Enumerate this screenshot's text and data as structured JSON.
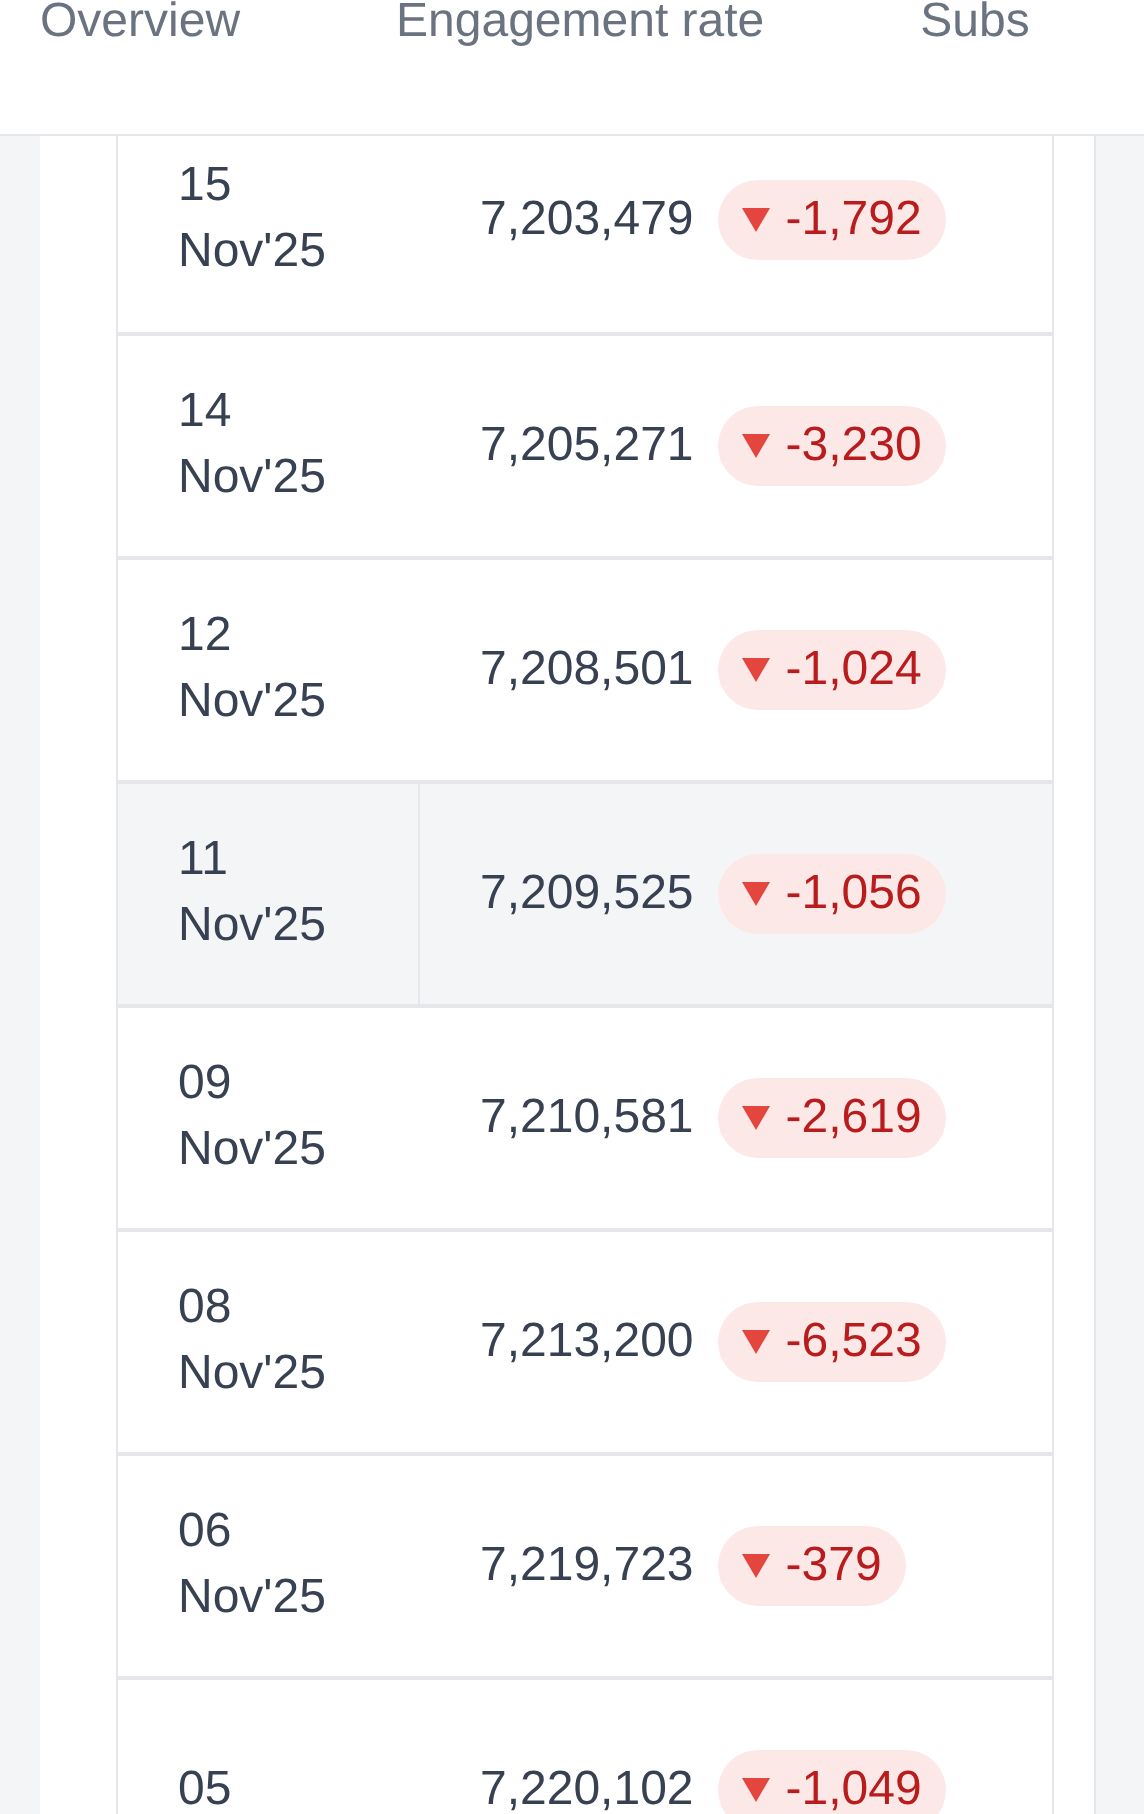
{
  "tabs": [
    {
      "label": "Overview",
      "selected": false
    },
    {
      "label": "Engagement rate",
      "selected": false
    },
    {
      "label": "Subs",
      "selected": false
    }
  ],
  "rows": [
    {
      "day": "15",
      "month": "Nov'25",
      "value": "7,203,479",
      "change": "-1,792",
      "kind": "down",
      "selected": false
    },
    {
      "day": "14",
      "month": "Nov'25",
      "value": "7,205,271",
      "change": "-3,230",
      "kind": "down",
      "selected": false
    },
    {
      "day": "12",
      "month": "Nov'25",
      "value": "7,208,501",
      "change": "-1,024",
      "kind": "down",
      "selected": false
    },
    {
      "day": "11",
      "month": "Nov'25",
      "value": "7,209,525",
      "change": "-1,056",
      "kind": "down",
      "selected": true
    },
    {
      "day": "09",
      "month": "Nov'25",
      "value": "7,210,581",
      "change": "-2,619",
      "kind": "down",
      "selected": false
    },
    {
      "day": "08",
      "month": "Nov'25",
      "value": "7,213,200",
      "change": "-6,523",
      "kind": "down",
      "selected": false
    },
    {
      "day": "06",
      "month": "Nov'25",
      "value": "7,219,723",
      "change": "-379",
      "kind": "down",
      "selected": false
    },
    {
      "day": "05",
      "value": "7,220,102",
      "change": "-1,049",
      "kind": "down",
      "selected": false
    }
  ]
}
